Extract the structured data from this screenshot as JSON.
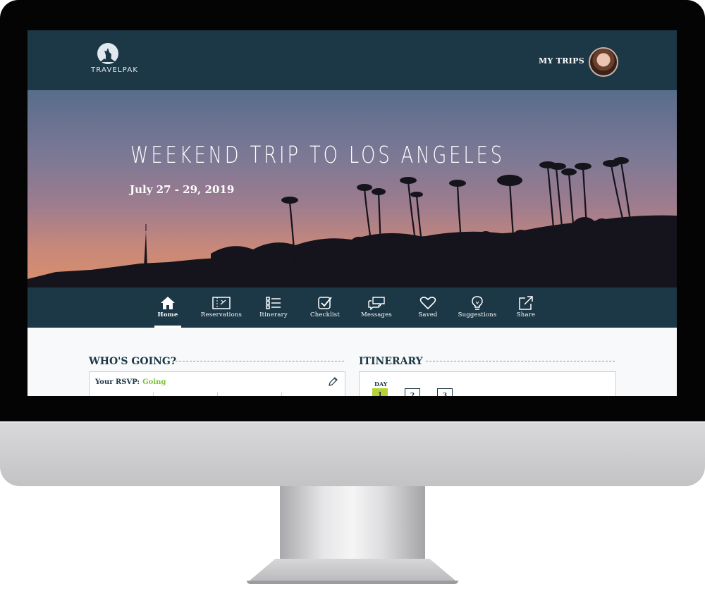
{
  "app": {
    "name": "TRAVELPAK"
  },
  "header": {
    "my_trips_label": "MY TRIPS",
    "avatar_icon": "user-avatar"
  },
  "hero": {
    "title": "WEEKEND TRIP TO LOS ANGELES",
    "dates": "July 27 - 29, 2019"
  },
  "nav": {
    "items": [
      {
        "label": "Home",
        "icon": "home-icon",
        "active": true
      },
      {
        "label": "Reservations",
        "icon": "ticket-icon",
        "active": false
      },
      {
        "label": "Itinerary",
        "icon": "list-icon",
        "active": false
      },
      {
        "label": "Checklist",
        "icon": "checklist-icon",
        "active": false
      },
      {
        "label": "Messages",
        "icon": "messages-icon",
        "active": false
      },
      {
        "label": "Saved",
        "icon": "heart-icon",
        "active": false
      },
      {
        "label": "Suggestions",
        "icon": "lightbulb-icon",
        "active": false
      },
      {
        "label": "Share",
        "icon": "share-icon",
        "active": false
      }
    ]
  },
  "whos_going": {
    "title": "WHO'S GOING?",
    "rsvp_label": "Your RSVP:",
    "rsvp_value": "Going"
  },
  "itinerary": {
    "title": "ITINERARY",
    "day_label": "DAY",
    "days": [
      {
        "number": "1",
        "selected": true
      },
      {
        "number": "2",
        "selected": false
      },
      {
        "number": "3",
        "selected": false
      }
    ]
  },
  "colors": {
    "navy": "#1c3746",
    "accent_green": "#7bc233",
    "day_selected": "#b5d236"
  }
}
